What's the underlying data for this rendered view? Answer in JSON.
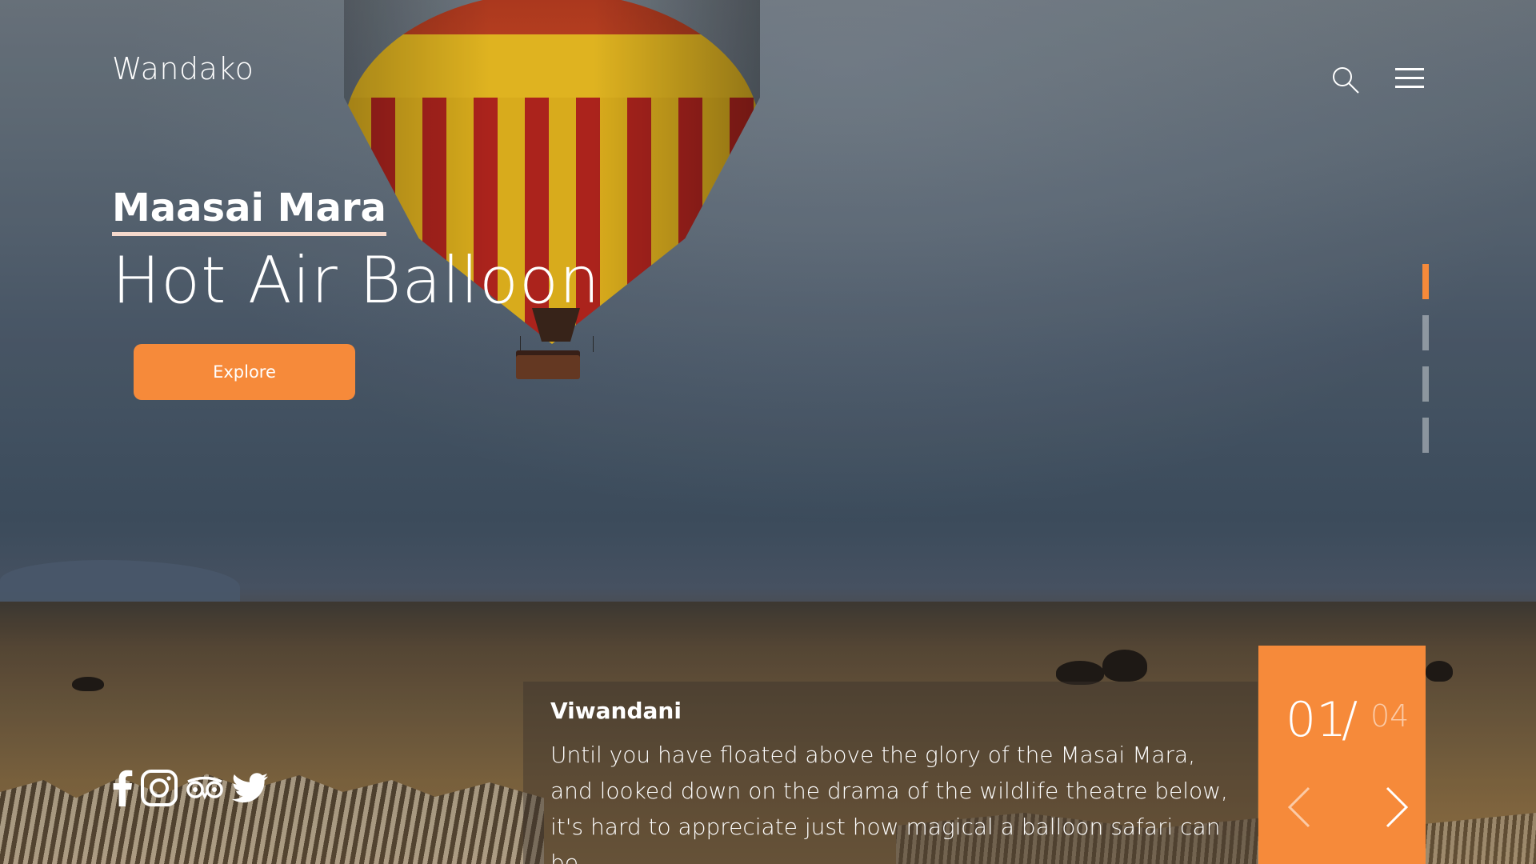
{
  "header": {
    "brand": "Wandako",
    "search_icon": "search-icon",
    "menu_icon": "hamburger-menu-icon"
  },
  "hero": {
    "subtitle": "Maasai Mara",
    "title": "Hot Air Balloon",
    "explore_label": "Explore"
  },
  "pager": {
    "total": 4,
    "active_index": 0
  },
  "social": {
    "icons": [
      "facebook-icon",
      "instagram-icon",
      "tripadvisor-icon",
      "twitter-icon"
    ]
  },
  "card": {
    "title": "Viwandani",
    "body": "Until you have floated above the glory of the Masai Mara, and looked down on the drama of the wildlife theatre below, it's hard to appreciate just how magical a balloon safari can be."
  },
  "counter": {
    "current": "01",
    "separator": "/",
    "total": "04",
    "prev_icon": "chevron-left-icon",
    "next_icon": "chevron-right-icon"
  },
  "colors": {
    "accent": "#f68a3a",
    "text": "#ffffff",
    "underline": "#f5d9cc",
    "pager_inactive": "#c8cdd2"
  }
}
